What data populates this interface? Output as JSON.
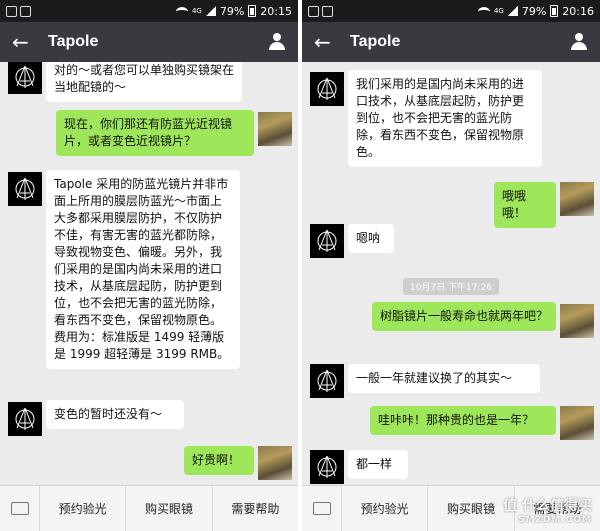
{
  "left": {
    "status": {
      "battery": "79%",
      "time": "20:15",
      "network": "4G"
    },
    "title": "Tapole",
    "messages": [
      {
        "side": "in",
        "text": "对的～或者您可以单独购买镜架在当地配镜的～"
      },
      {
        "side": "out",
        "text": "现在，你们那还有防蓝光近视镜片，或者变色近视镜片？"
      },
      {
        "side": "in",
        "text": "Tapole 采用的防蓝光镜片并非市面上所用的膜层防蓝光～市面上大多都采用膜层防护，不仅防护不佳，有害无害的蓝光都防除，导致视物变色、偏暖。另外，我们采用的是国内尚未采用的进口技术，从基底层起防，防护更到位，也不会把无害的蓝光防除，看东西不变色，保留视物原色。费用为：标准版是 1499 轻薄版是 1999 超轻薄是 3199 RMB。"
      },
      {
        "side": "in",
        "text": "变色的暂时还没有～"
      },
      {
        "side": "out",
        "text": "好贵啊！"
      }
    ],
    "menu": [
      "预约验光",
      "购买眼镜",
      "需要帮助"
    ]
  },
  "right": {
    "status": {
      "battery": "79%",
      "time": "20:16",
      "network": "4G"
    },
    "title": "Tapole",
    "messages": [
      {
        "side": "in",
        "text": "我们采用的是国内尚未采用的进口技术，从基底层起防，防护更到位，也不会把无害的蓝光防除，看东西不变色，保留视物原色。"
      },
      {
        "side": "out",
        "text": "哦哦哦！"
      },
      {
        "side": "in",
        "text": "嗯呐"
      },
      {
        "side": "time",
        "text": "10月7日 下午17:26"
      },
      {
        "side": "out",
        "text": "树脂镜片一般寿命也就两年吧？"
      },
      {
        "side": "in",
        "text": "一般一年就建议换了的其实～"
      },
      {
        "side": "out",
        "text": "哇咔咔！那种贵的也是一年？"
      },
      {
        "side": "in",
        "text": "都一样"
      }
    ],
    "menu": [
      "预约验光",
      "购买眼镜",
      "需要帮助"
    ]
  },
  "watermark": {
    "line1": "值 什么值得买",
    "line2": "SMZDM.COM"
  },
  "colors": {
    "appbar": "#393a3f",
    "chat_bg": "#ebebeb",
    "out_bubble": "#9fe75a",
    "in_bubble": "#ffffff"
  },
  "icons": [
    "back-arrow-icon",
    "user-icon",
    "keyboard-icon",
    "tapole-logo-icon",
    "wifi-icon",
    "signal-icon",
    "battery-icon"
  ]
}
